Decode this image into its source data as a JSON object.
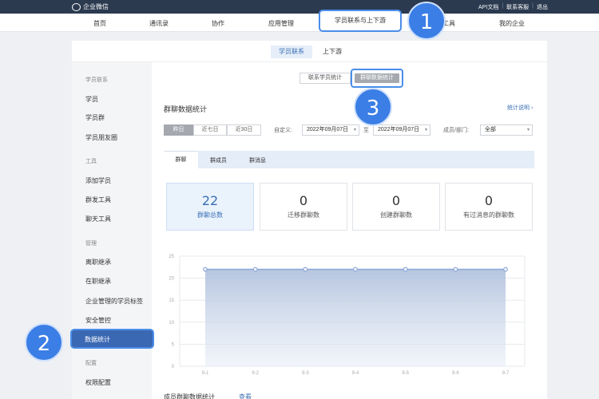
{
  "topbar": {
    "brand": "企业微信",
    "links": [
      "API文档",
      "联系客服",
      "退出"
    ]
  },
  "nav": {
    "items": [
      "首页",
      "通讯录",
      "协作",
      "应用管理",
      "学员联系与上下游",
      "工具",
      "我的企业"
    ],
    "active": "学员联系与上下游"
  },
  "callouts": [
    "1",
    "2",
    "3"
  ],
  "subtabs": [
    "学员联系",
    "上下游"
  ],
  "sidebar": {
    "groups": [
      "学员联系",
      "工具",
      "管理",
      "配置"
    ],
    "items_contact": [
      "学员",
      "学员群",
      "学员朋友圈"
    ],
    "items_tools": [
      "添加学员",
      "群发工具",
      "聊天工具"
    ],
    "items_manage": [
      "离职继承",
      "在职继承",
      "企业管理的学员标签",
      "安全管控",
      "数据统计"
    ],
    "items_config": [
      "权限配置"
    ],
    "active": "数据统计"
  },
  "segment": {
    "left": "联系学员统计",
    "right": "群聊数据统计"
  },
  "section": {
    "title": "群聊数据统计",
    "help": "统计说明 ›"
  },
  "filters": {
    "ranges": [
      "昨日",
      "近七日",
      "近30日"
    ],
    "custom_label": "自定义:",
    "start_date": "2022年09月07日",
    "to": "至",
    "end_date": "2022年09月07日",
    "member_label": "成员/部门:",
    "member_value": "全部"
  },
  "tabs": [
    "群聊",
    "群成员",
    "群消息"
  ],
  "stats": [
    {
      "value": "22",
      "label": "群聊总数"
    },
    {
      "value": "0",
      "label": "迁移群聊数"
    },
    {
      "value": "0",
      "label": "创建群聊数"
    },
    {
      "value": "0",
      "label": "有过消息的群聊数"
    }
  ],
  "chart_data": {
    "type": "area",
    "x": [
      "9-1",
      "9-2",
      "9-3",
      "9-4",
      "9-5",
      "9-6",
      "9-7"
    ],
    "series": [
      {
        "values": [
          22,
          22,
          22,
          22,
          22,
          22,
          22
        ]
      }
    ],
    "yticks": [
      0,
      5,
      10,
      15,
      20,
      25
    ],
    "ylim": [
      0,
      25
    ],
    "grid": true,
    "color": "#8aa7d6"
  },
  "bottom": {
    "title": "成员群聊数据统计",
    "link": "查看"
  }
}
